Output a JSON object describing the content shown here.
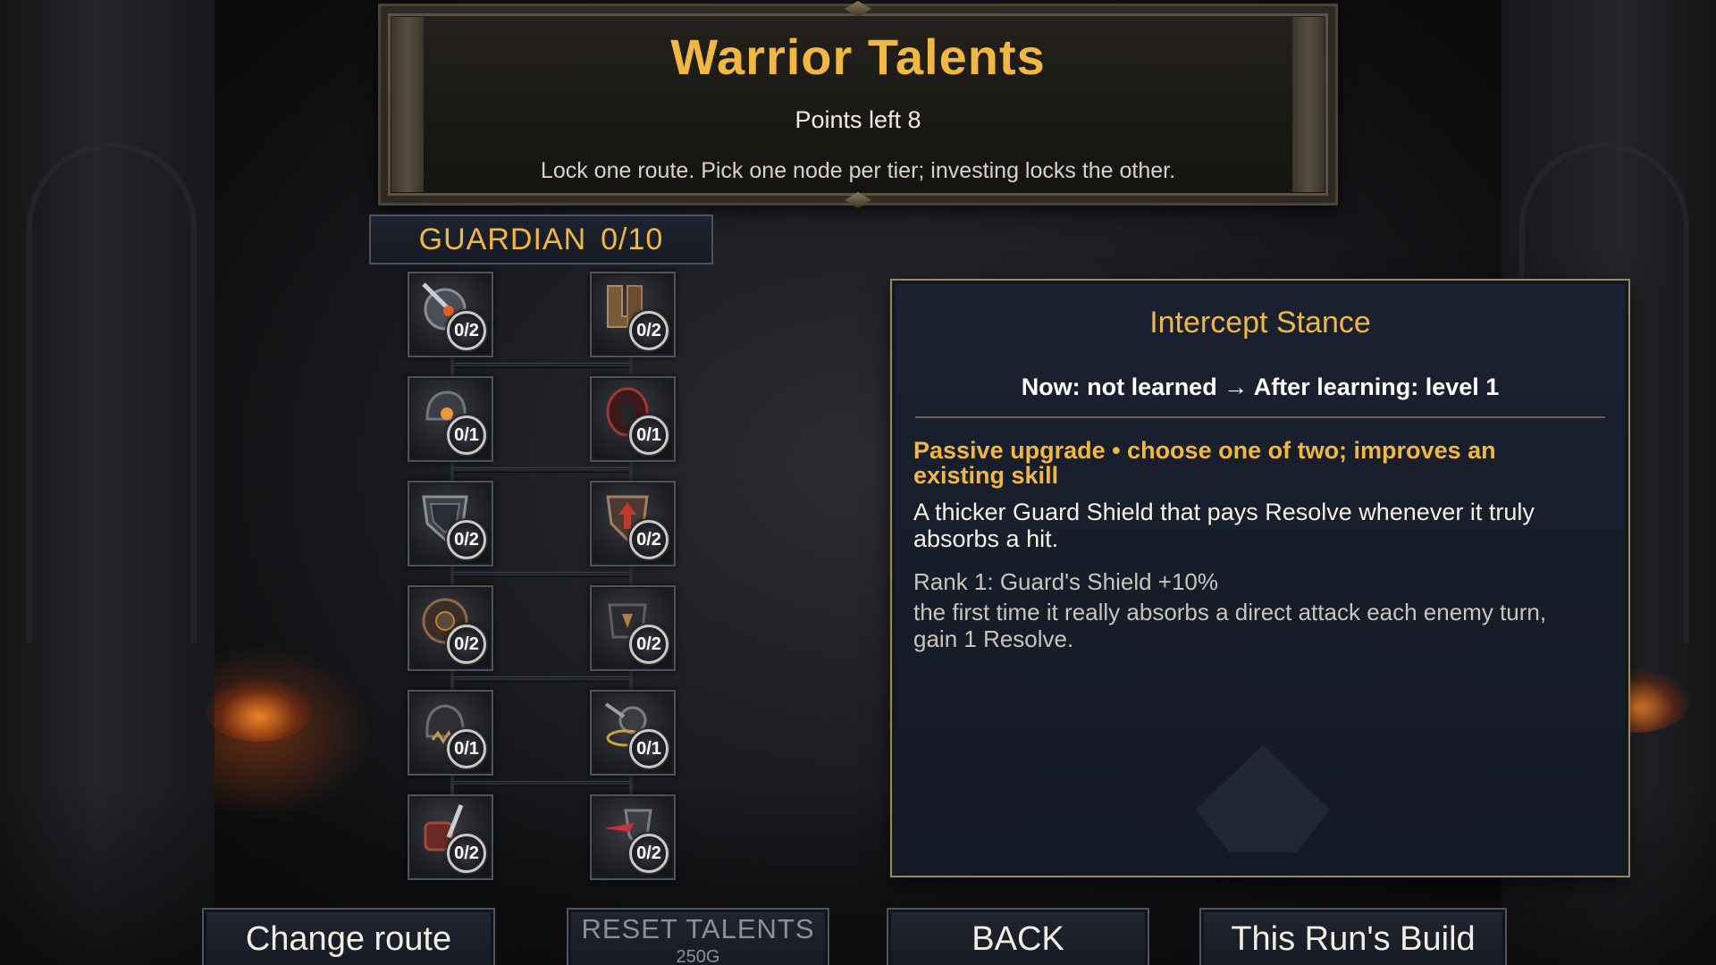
{
  "header": {
    "title": "Warrior Talents",
    "points_left": "Points left 8",
    "hint": "Lock one route. Pick one node per tier; investing locks the other."
  },
  "route": {
    "name": "GUARDIAN",
    "progress": "0/10"
  },
  "talents": {
    "tiers": [
      {
        "left": {
          "icon": "shield-sword-icon",
          "rank": "0/2"
        },
        "right": {
          "icon": "armored-boots-icon",
          "rank": "0/2"
        }
      },
      {
        "left": {
          "icon": "helmet-strike-icon",
          "rank": "0/1"
        },
        "right": {
          "icon": "red-helm-icon",
          "rank": "0/1"
        }
      },
      {
        "left": {
          "icon": "layered-shield-icon",
          "rank": "0/2"
        },
        "right": {
          "icon": "arrow-shield-icon",
          "rank": "0/2"
        }
      },
      {
        "left": {
          "icon": "round-buckler-icon",
          "rank": "0/2"
        },
        "right": {
          "icon": "dark-armor-icon",
          "rank": "0/2"
        }
      },
      {
        "left": {
          "icon": "spiked-helm-icon",
          "rank": "0/1"
        },
        "right": {
          "icon": "mace-ring-icon",
          "rank": "0/1"
        }
      },
      {
        "left": {
          "icon": "gauntlet-sword-icon",
          "rank": "0/2"
        },
        "right": {
          "icon": "blade-shield-icon",
          "rank": "0/2"
        }
      }
    ]
  },
  "detail": {
    "name": "Intercept Stance",
    "level_change": "Now: not learned → After learning: level 1",
    "type": "Passive upgrade  •  choose one of two; improves an existing skill",
    "description": "A thicker Guard Shield that pays Resolve whenever it truly absorbs a hit.",
    "rank_line": "Rank 1: Guard's Shield +10%",
    "effect": "the first time it really absorbs a direct attack each enemy turn, gain 1 Resolve."
  },
  "footer": {
    "change_route": "Change route",
    "reset_label": "RESET TALENTS",
    "reset_cost": "250G",
    "back": "BACK",
    "build": "This Run's Build"
  },
  "colors": {
    "accent_gold": "#f0b840",
    "panel_border": "#9c8a5d",
    "panel_bg": "#1b2130"
  }
}
